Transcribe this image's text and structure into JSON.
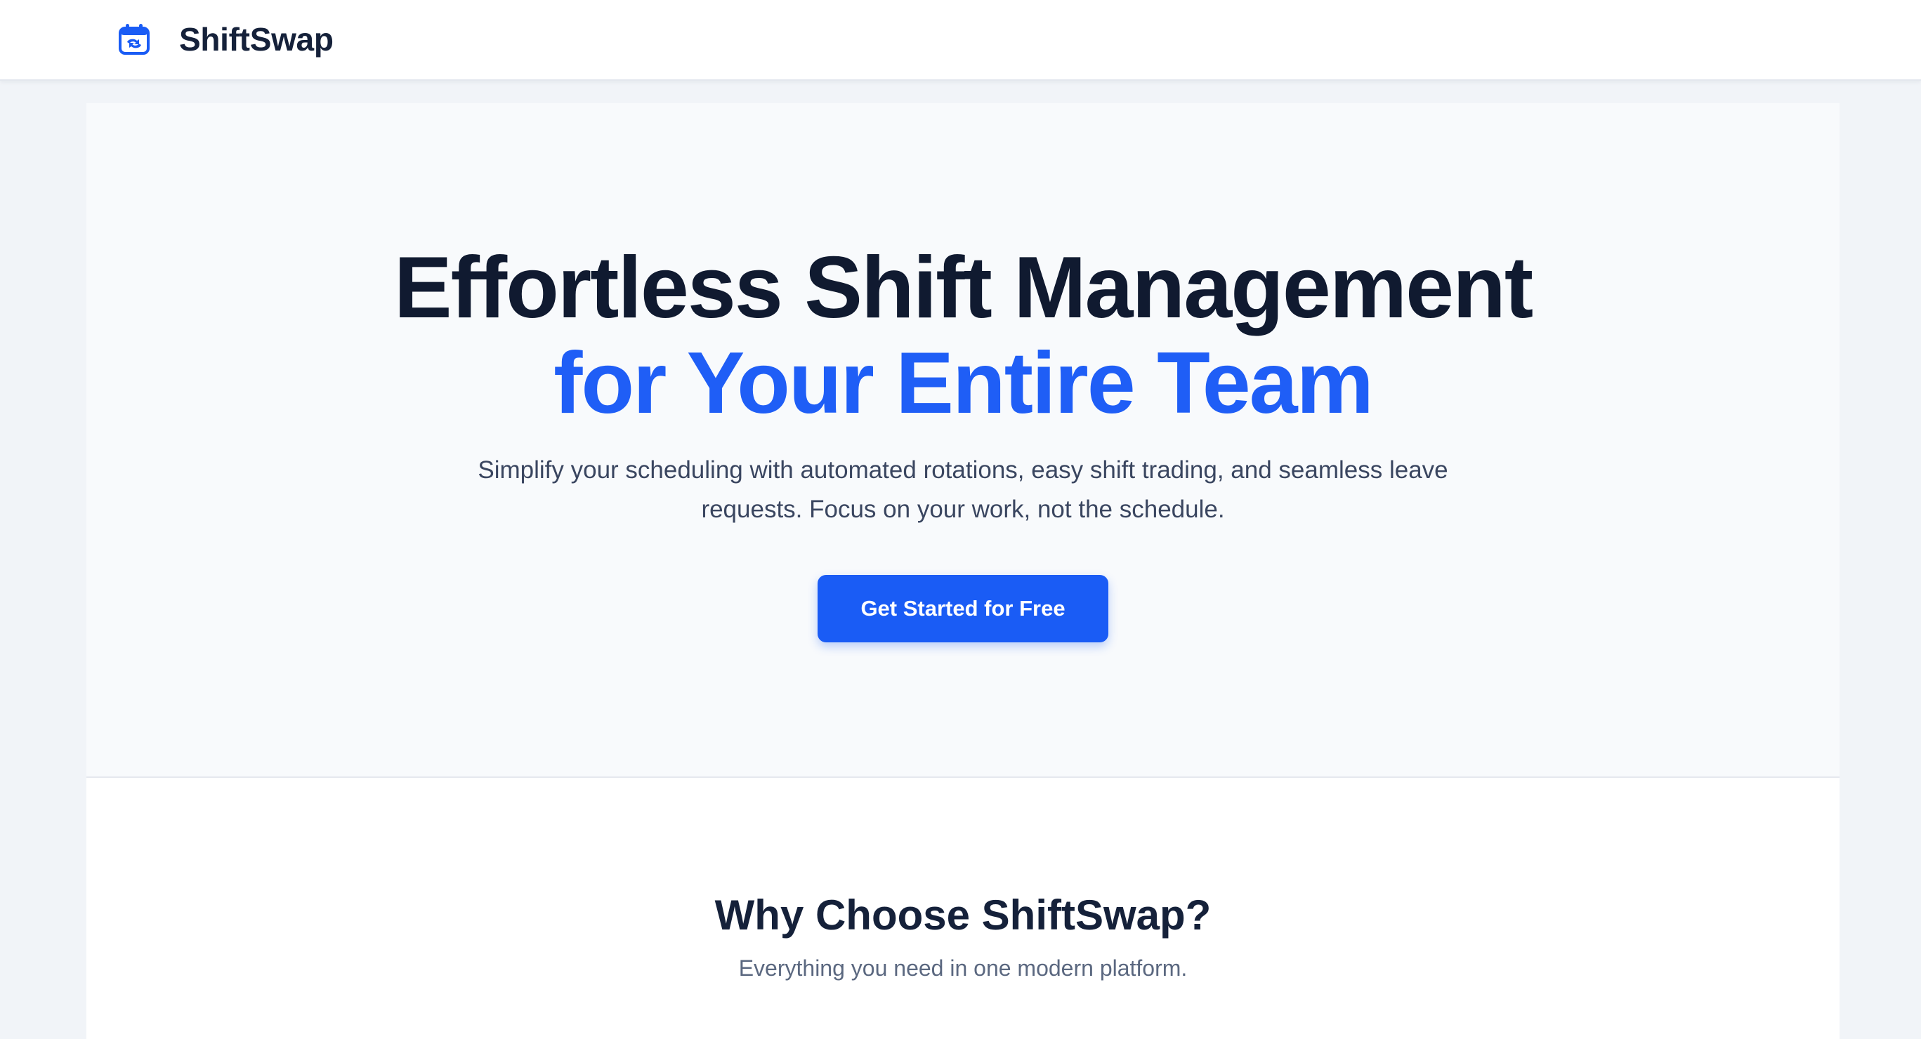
{
  "header": {
    "brand": "ShiftSwap",
    "logo_icon": "calendar-swap-icon"
  },
  "hero": {
    "title_line1": "Effortless Shift Management",
    "title_line2": "for Your Entire Team",
    "subtitle": "Simplify your scheduling with automated rotations, easy shift trading, and seamless leave requests. Focus on your work, not the schedule.",
    "cta_label": "Get Started for Free"
  },
  "features": {
    "title": "Why Choose ShiftSwap?",
    "subtitle": "Everything you need in one modern platform."
  },
  "colors": {
    "accent": "#1a5cf5",
    "heading": "#101a30",
    "page_bg": "#f1f4f8"
  }
}
